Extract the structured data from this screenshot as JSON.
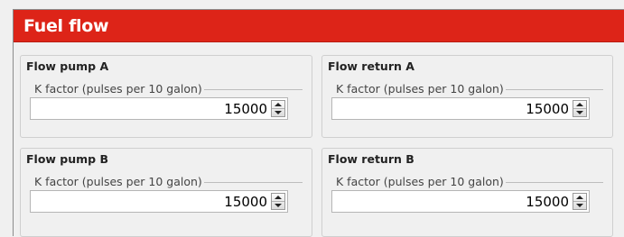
{
  "header": {
    "title": "Fuel flow"
  },
  "groups": [
    {
      "title": "Flow pump A",
      "field_label": "K factor (pulses per 10 galon)",
      "value": "15000"
    },
    {
      "title": "Flow return A",
      "field_label": "K factor (pulses per 10 galon)",
      "value": "15000"
    },
    {
      "title": "Flow pump B",
      "field_label": "K factor (pulses per 10 galon)",
      "value": "15000"
    },
    {
      "title": "Flow return B",
      "field_label": "K factor (pulses per 10 galon)",
      "value": "15000"
    }
  ],
  "icons": {
    "spin_up": "arrow-up-icon",
    "spin_down": "arrow-down-icon"
  },
  "colors": {
    "header_bg": "#dd2418",
    "header_text": "#ffffff"
  }
}
